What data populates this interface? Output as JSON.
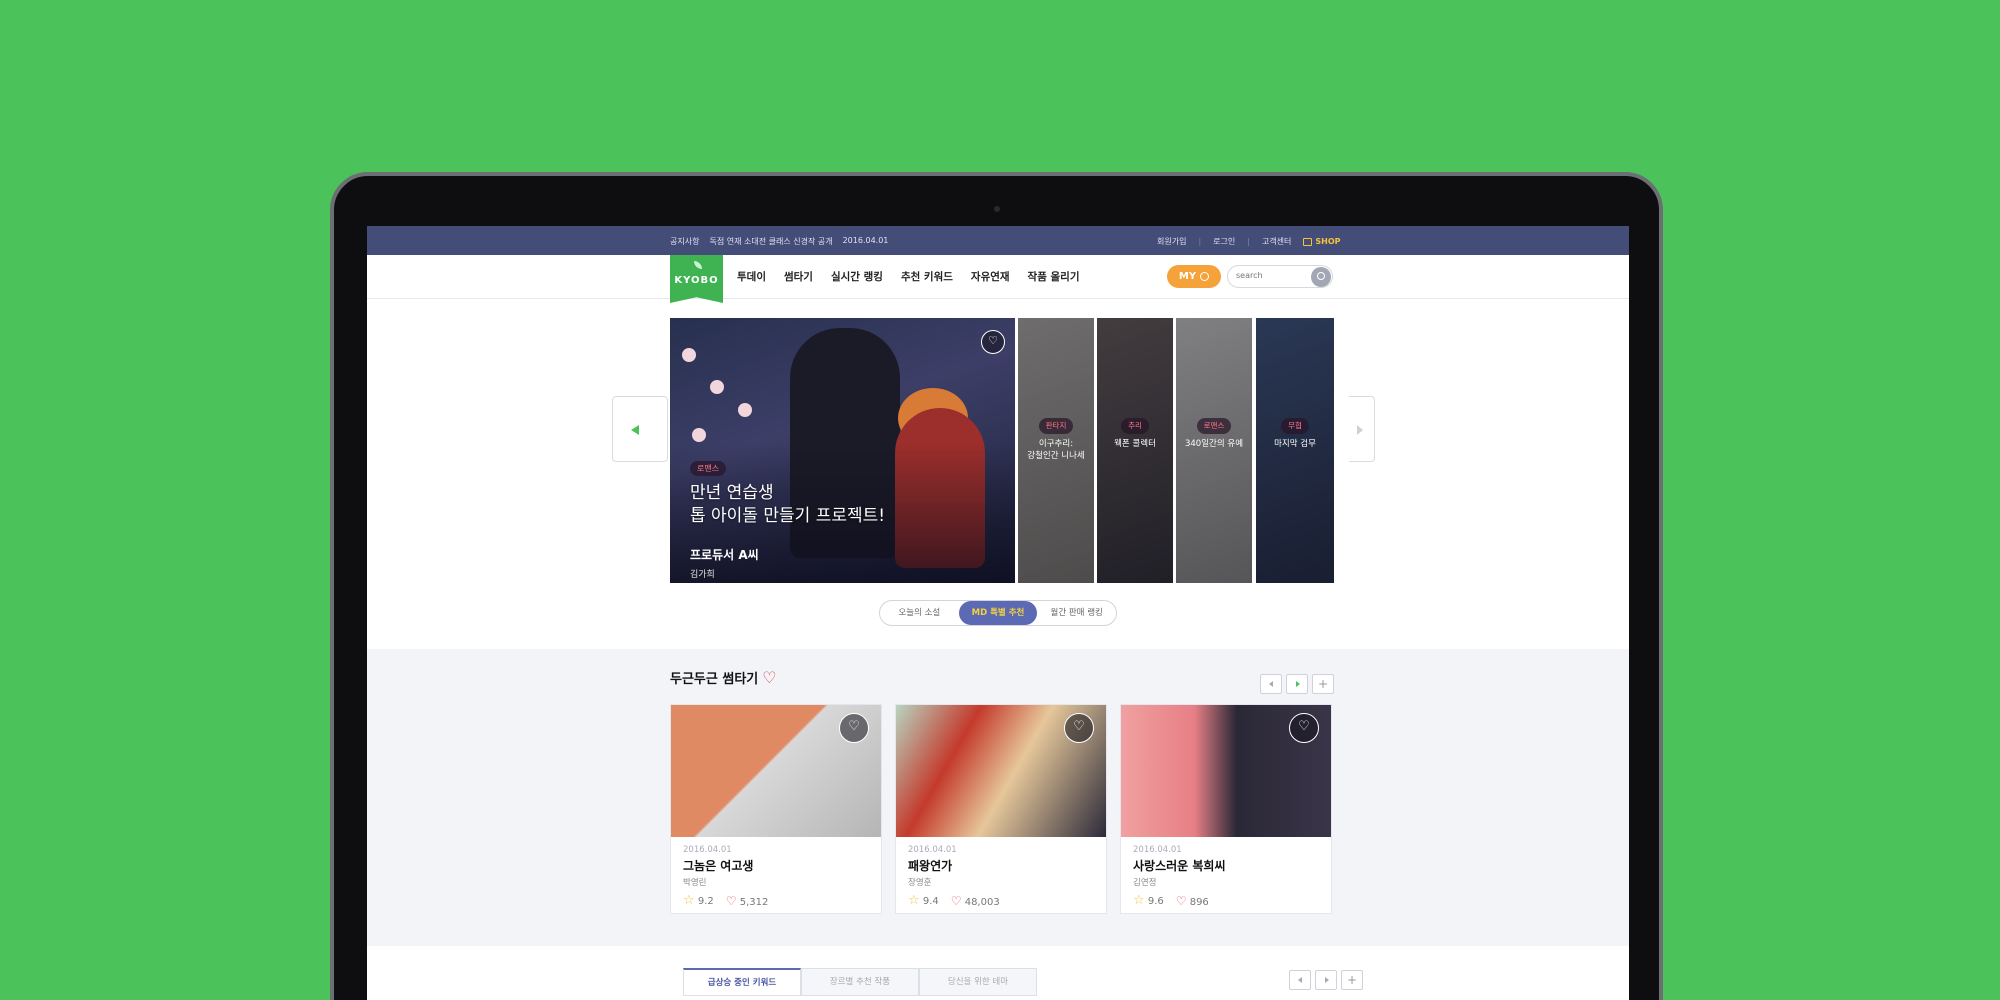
{
  "topbar": {
    "notice_label": "공지사항",
    "notice_text": "독점 연재 소대전 클래스 신경작 공개",
    "notice_date": "2016.04.01",
    "links": [
      "회원가입",
      "로그인",
      "고객센터"
    ],
    "shop_label": "SHOP"
  },
  "nav": {
    "logo": "KYOBO",
    "menu": [
      "투데이",
      "썸타기",
      "실시간 랭킹",
      "추천 키워드",
      "자유연재",
      "작품 올리기"
    ],
    "my_label": "MY",
    "search_placeholder": "search"
  },
  "hero": {
    "main": {
      "genre": "로맨스",
      "headline_line1": "만년 연습생",
      "headline_line2": "톱 아이돌 만들기 프로젝트!",
      "title": "프로듀서 A씨",
      "author": "김가희"
    },
    "side_slides": [
      {
        "genre": "판타지",
        "title_line1": "이구추리:",
        "title_line2": "강철인간 니나세"
      },
      {
        "genre": "추리",
        "title_line1": "웩폰 콜렉터",
        "title_line2": ""
      },
      {
        "genre": "로맨스",
        "title_line1": "340일간의 유예",
        "title_line2": ""
      },
      {
        "genre": "무협",
        "title_line1": "마지막 검무",
        "title_line2": ""
      }
    ],
    "tabs": [
      {
        "label": "오늘의 소설",
        "active": false
      },
      {
        "label": "MD 특별 추천",
        "active": true
      },
      {
        "label": "월간 판매 랭킹",
        "active": false
      }
    ]
  },
  "section_some": {
    "title": "두근두근 썸타기",
    "cards": [
      {
        "date": "2016.04.01",
        "title": "그놈은 여고생",
        "author": "박영린",
        "rating": "9.2",
        "likes": "5,312"
      },
      {
        "date": "2016.04.01",
        "title": "패왕연가",
        "author": "장영훈",
        "rating": "9.4",
        "likes": "48,003"
      },
      {
        "date": "2016.04.01",
        "title": "사랑스러운 복희씨",
        "author": "김연정",
        "rating": "9.6",
        "likes": "896"
      }
    ]
  },
  "section_keyword": {
    "tabs": [
      {
        "label": "급상승 중인 키워드",
        "active": true
      },
      {
        "label": "장르별 추천 작품",
        "active": false
      },
      {
        "label": "당신을 위한 테마",
        "active": false
      }
    ]
  },
  "colors": {
    "background": "#4cc25a",
    "topbar": "#444d78",
    "accent": "#5c6ab3",
    "my_button": "#f5a23a",
    "logo": "#3fb352"
  }
}
